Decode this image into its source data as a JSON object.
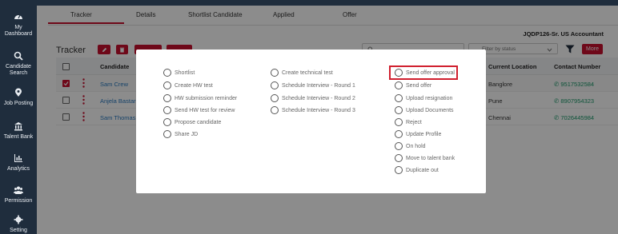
{
  "sidebar": {
    "items": [
      {
        "icon": "dashboard-icon",
        "line1": "My",
        "line2": "Dashboard"
      },
      {
        "icon": "search-icon",
        "line1": "Candidate",
        "line2": "Search"
      },
      {
        "icon": "location-pin-icon",
        "line1": "Job Posting",
        "line2": ""
      },
      {
        "icon": "bank-icon",
        "line1": "Talent Bank",
        "line2": ""
      },
      {
        "icon": "analytics-icon",
        "line1": "Analytics",
        "line2": ""
      },
      {
        "icon": "users-icon",
        "line1": "Permission",
        "line2": ""
      },
      {
        "icon": "gear-icon",
        "line1": "Setting",
        "line2": ""
      }
    ]
  },
  "tabs": [
    "Tracker",
    "Details",
    "Shortlist Candidate",
    "Applied",
    "Offer"
  ],
  "job_id": "JQDP126-Sr. US Accountant",
  "tracker": {
    "title": "Tracker",
    "status_placeholder": "Filter by status",
    "more_label": "More"
  },
  "table": {
    "headers": {
      "candidate": "Candidate",
      "location": "Current Location",
      "contact": "Contact Number"
    },
    "rows": [
      {
        "name": "Sam Crew",
        "location": "Banglore",
        "phone": "9517532584",
        "checked": true
      },
      {
        "name": "Anjela Bastard",
        "location": "Pune",
        "phone": "8907954323",
        "checked": false
      },
      {
        "name": "Sam Thomas",
        "location": "Chennai",
        "phone": "7026445984",
        "checked": false
      }
    ]
  },
  "modal": {
    "col1": [
      "Shortlist",
      "Create HW test",
      "HW submission reminder",
      "Send HW test for review",
      "Propose candidate",
      "Share JD"
    ],
    "col2": [
      "Create technical test",
      "Schedule Interview - Round 1",
      "Schedule Interview - Round 2",
      "Schedule Interview - Round 3"
    ],
    "col3": [
      "Send offer approval",
      "Send offer",
      "Upload resignation",
      "Upload Documents",
      "Reject",
      "Update Profile",
      "On hold",
      "Move to talent bank",
      "Duplicate out"
    ]
  },
  "colors": {
    "accent": "#c8102e",
    "sidebar": "#1f2d3d",
    "link": "#2a7ac0",
    "phone": "#1a9a6a"
  }
}
